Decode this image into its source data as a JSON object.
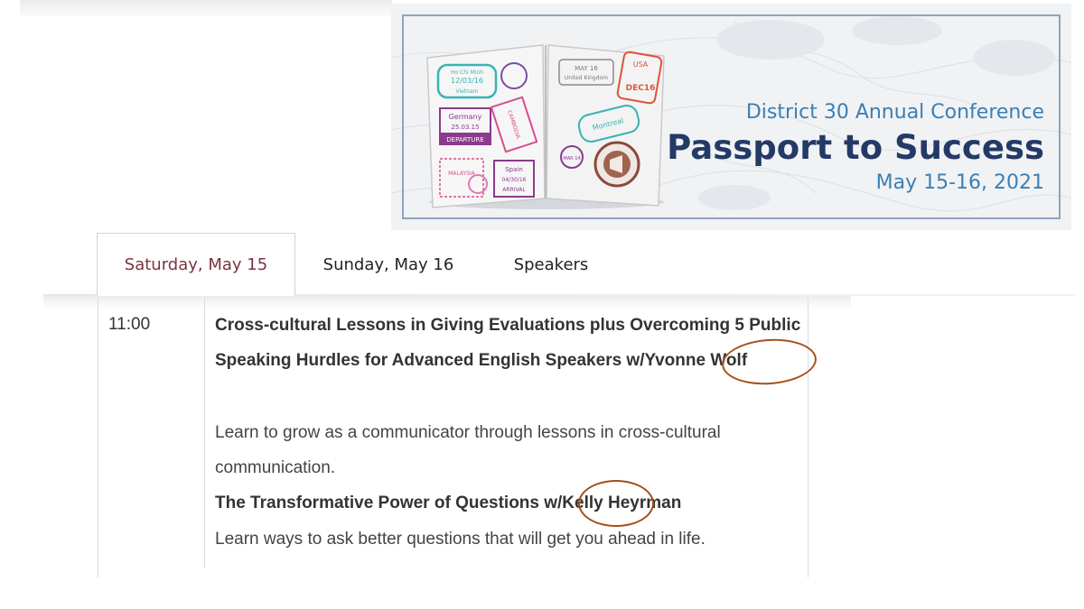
{
  "banner": {
    "subtitle": "District 30 Annual Conference",
    "title": "Passport to Success",
    "dates": "May 15-16, 2021",
    "stamps": {
      "hochiminh": "Ho Chi Minh",
      "hcm_date": "12/03/16",
      "vietnam": "Vietnam",
      "germany": "Germany",
      "germany_date": "25.03.15",
      "departure": "DEPARTURE",
      "malaysia": "MALAYSIA",
      "spain": "Spain",
      "spain_date": "04/30/16",
      "arrival": "ARRIVAL",
      "may16": "MAY 16",
      "uk": "United Kingdom",
      "usa": "USA",
      "dec16": "DEC16",
      "montreal": "Montreal",
      "cambodia": "CAMBODIA",
      "mar14": "MAR 14"
    }
  },
  "tabs": [
    {
      "label": "Saturday, May 15",
      "active": true
    },
    {
      "label": "Sunday, May 16",
      "active": false
    },
    {
      "label": "Speakers",
      "active": false
    }
  ],
  "schedule": {
    "time": "11:00",
    "sessions": [
      {
        "title": "Cross-cultural Lessons in Giving Evaluations plus Overcoming 5 Public Speaking Hurdles for Advanced English Speakers w/Yvonne Wolf",
        "description": "Learn to grow as a communicator through lessons in cross-cultural communication."
      },
      {
        "title": "The Transformative Power of Questions w/Kelly Heyrman",
        "description": "Learn ways to ask better questions that will get you ahead in life."
      }
    ]
  },
  "colors": {
    "active_tab": "#7a3340",
    "circle": "#a4501b",
    "banner_title": "#243a66",
    "banner_accent": "#3a7fb6"
  }
}
